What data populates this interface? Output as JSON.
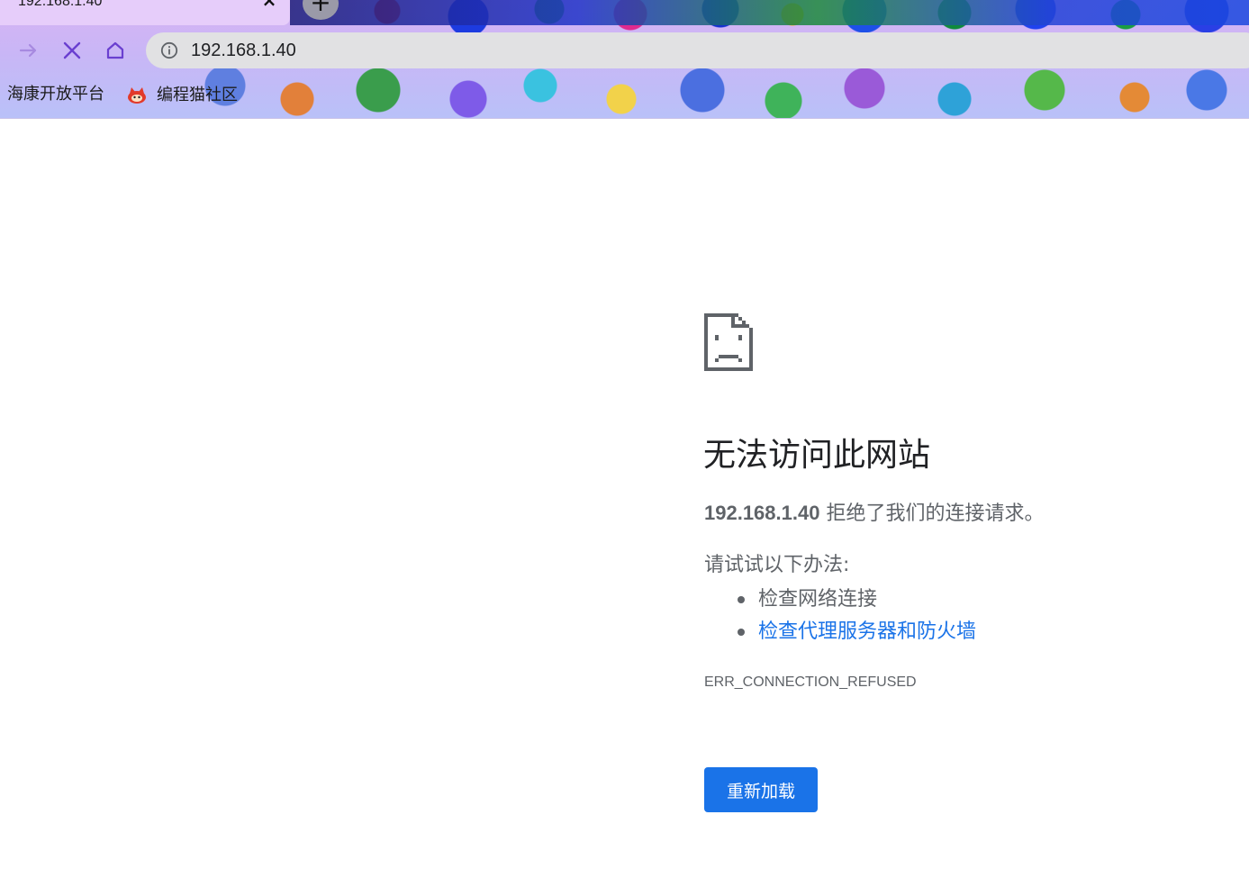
{
  "browser": {
    "tab": {
      "title": "192.168.1.40",
      "close_glyph": "×"
    },
    "new_tab_glyph": "+",
    "nav": {
      "forward_icon": "forward-arrow-icon",
      "stop_icon": "stop-x-icon",
      "home_icon": "home-icon",
      "accent_color": "#7b4bd8"
    },
    "omnibox": {
      "info_icon": "info-icon",
      "url": "192.168.1.40",
      "background": "#e1e1e3"
    },
    "bookmarks": [
      {
        "label": "海康开放平台"
      },
      {
        "label": "编程猫社区",
        "icon": "codemao-favicon"
      }
    ]
  },
  "error_page": {
    "icon": "sad-document-icon",
    "title": "无法访问此网站",
    "summary_host": "192.168.1.40",
    "summary_text": " 拒绝了我们的连接请求。",
    "suggestions_heading": "请试试以下办法:",
    "suggestions": [
      {
        "label": "检查网络连接",
        "is_link": false
      },
      {
        "label": "检查代理服务器和防火墙",
        "is_link": true
      }
    ],
    "error_code": "ERR_CONNECTION_REFUSED",
    "reload_label": "重新加载",
    "colors": {
      "title": "#202124",
      "body": "#5f6368",
      "link": "#1a73e8",
      "button": "#1a73e8"
    }
  }
}
